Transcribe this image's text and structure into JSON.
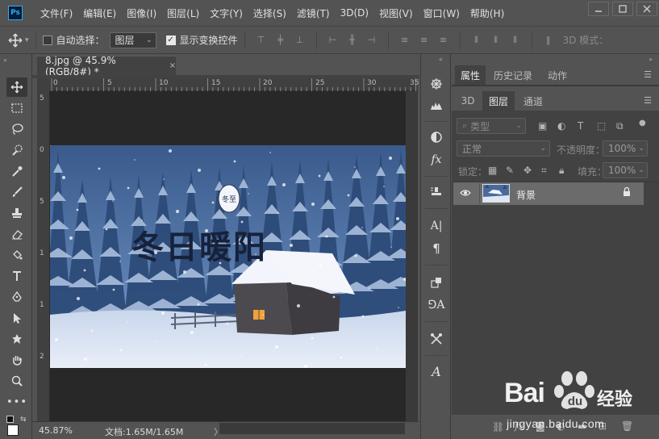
{
  "menubar": {
    "logo": "Ps",
    "items": [
      "文件(F)",
      "编辑(E)",
      "图像(I)",
      "图层(L)",
      "文字(Y)",
      "选择(S)",
      "滤镜(T)",
      "3D(D)",
      "视图(V)",
      "窗口(W)",
      "帮助(H)"
    ]
  },
  "options": {
    "auto_select_label": "自动选择：",
    "auto_select_target": "图层",
    "show_transform_label": "显示变换控件",
    "mode_3d_label": "3D 模式："
  },
  "document": {
    "tab_title": "8.jpg @ 45.9%(RGB/8#) *",
    "close": "×",
    "image_title_text": "冬日暖阳",
    "seal_text": "冬至"
  },
  "ruler": {
    "top": [
      "0",
      "5",
      "10",
      "15",
      "20",
      "25",
      "30",
      "35"
    ],
    "left": [
      "5",
      "0",
      "5",
      "1",
      "1",
      "2"
    ]
  },
  "status": {
    "zoom": "45.87%",
    "doc_info": "文档:1.65M/1.65M",
    "arrow": "〉"
  },
  "panels": {
    "top_tabs": [
      "属性",
      "历史记录",
      "动作"
    ],
    "layer_tabs": [
      "3D",
      "图层",
      "通道"
    ],
    "kind_filter": "类型",
    "blend_mode": "正常",
    "opacity_label": "不透明度：",
    "opacity_value": "100%",
    "lock_label": "锁定：",
    "fill_label": "填充：",
    "fill_value": "100%",
    "layers": [
      {
        "name": "背景",
        "visible": true,
        "locked": true
      }
    ]
  },
  "watermark": {
    "brand": "Bai",
    "brand2": "du",
    "cn": "经验",
    "url": "jingyan.baidu.com"
  },
  "colors": {
    "ui_bg": "#535353",
    "panel_dark": "#424242",
    "pasteboard": "#282828",
    "accent_ps": "#31a8ff"
  }
}
